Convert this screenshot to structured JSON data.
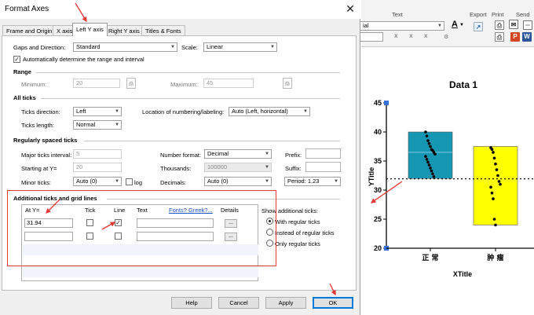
{
  "dialog": {
    "title": "Format Axes",
    "close_glyph": "✕",
    "tabs": [
      "Frame and Origin",
      "X axis",
      "Left Y axis",
      "Right Y axis",
      "Titles & Fonts"
    ],
    "active_tab": "Left Y axis",
    "gaps_label": "Gaps and Direction:",
    "gaps_value": "Standard",
    "scale_label": "Scale:",
    "scale_value": "Linear",
    "auto_range_label": "Automatically determine the range and interval",
    "auto_range_checked": true,
    "range_section": "Range",
    "minimum_label": "Minimum:",
    "minimum_value": "20",
    "maximum_label": "Maximum:",
    "maximum_value": "45",
    "ticks_section": "All ticks",
    "ticks_direction_label": "Ticks direction:",
    "ticks_direction_value": "Left",
    "location_label": "Location of numbering/labeling:",
    "location_value": "Auto (Left, horizontal)",
    "ticks_length_label": "Ticks length:",
    "ticks_length_value": "Normal",
    "regular_section": "Regularly spaced ticks",
    "major_interval_label": "Major ticks interval:",
    "major_interval_value": "5",
    "number_format_label": "Number format:",
    "number_format_value": "Decimal",
    "prefix_label": "Prefix:",
    "starting_label": "Starting at Y=",
    "starting_value": "20",
    "thousands_label": "Thousands:",
    "thousands_value": "100000",
    "suffix_label": "Suffix:",
    "minor_ticks_label": "Minor ticks:",
    "minor_ticks_value": "Auto (0)",
    "log_label": "log",
    "decimals_label": "Decimals:",
    "decimals_value": "Auto (0)",
    "period_value": "Period: 1.23",
    "additional_section": "Additional ticks and grid lines",
    "col_at_y": "At Y=",
    "col_tick": "Tick",
    "col_line": "Line",
    "col_text": "Text",
    "fonts_link": "Fonts? Greek?...",
    "col_details": "Details",
    "row1_value": "31.94",
    "row_details_btn": "...",
    "show_additional_label": "Show additional ticks:",
    "radio_options": [
      "With regular ticks",
      "Instead of regular ticks",
      "Only regular ticks"
    ],
    "radio_selected": 0,
    "btn_help": "Help",
    "btn_cancel": "Cancel",
    "btn_apply": "Apply",
    "btn_ok": "OK"
  },
  "ribbon": {
    "text_group": "Text",
    "export_group": "Export",
    "print_group": "Print",
    "send_group": "Send",
    "font_fragment": "ial"
  },
  "chart_data": {
    "type": "scatter",
    "title": "Data 1",
    "xlabel": "XTitle",
    "ylabel": "YTitle",
    "categories": [
      "正 常",
      "肿 瘤"
    ],
    "ylim": [
      20,
      45
    ],
    "yticks": [
      20,
      25,
      30,
      35,
      40,
      45
    ],
    "box_colors": [
      "#1597b4",
      "#ffff00"
    ],
    "boxes": [
      {
        "category": "正 常",
        "bottom": 32,
        "top": 40,
        "median": 36.5
      },
      {
        "category": "肿 瘤",
        "bottom": 24,
        "top": 37.5
      }
    ],
    "series": [
      {
        "category": "正 常",
        "values": [
          40,
          39.3,
          38.5,
          38,
          37.5,
          37,
          36.8,
          36.5,
          36.2,
          35.8,
          35.3,
          34.8,
          34.3,
          33.8,
          33.3,
          32.8,
          32.3
        ]
      },
      {
        "category": "肿 瘤",
        "values": [
          37.3,
          37,
          36.5,
          35.5,
          34.5,
          33.5,
          32.5,
          31.5,
          31,
          30.5,
          29.5,
          28.5,
          25,
          24
        ]
      }
    ],
    "reference_line": 31.94,
    "reference_line_style": "dotted"
  }
}
